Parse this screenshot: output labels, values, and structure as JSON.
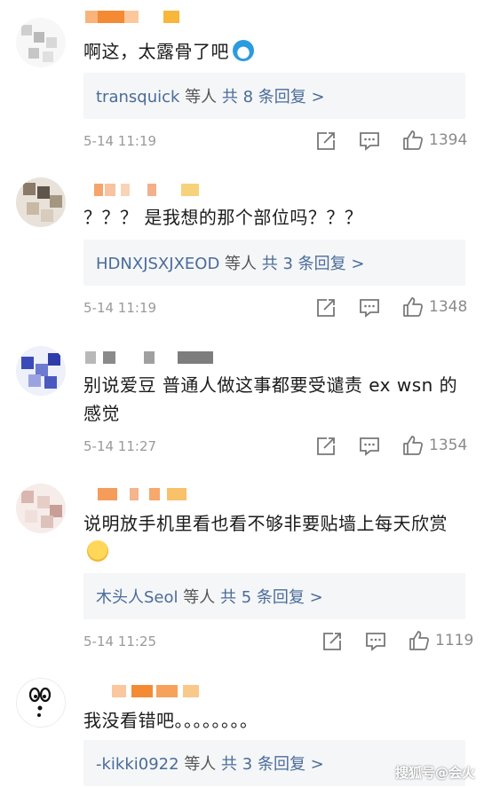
{
  "comments": [
    {
      "text": "啊这，太露骨了吧",
      "reply": {
        "user": "transquick",
        "suffix": "等人",
        "count_text": "共 8 条回复 >"
      },
      "time": "5-14 11:19",
      "likes": "1394"
    },
    {
      "text": "？？？ 是我想的那个部位吗？？？",
      "reply": {
        "user": "HDNXJSXJXEOD",
        "suffix": "等人",
        "count_text": "共 3 条回复 >"
      },
      "time": "5-14 11:19",
      "likes": "1348"
    },
    {
      "text": "别说爱豆 普通人做这事都要受谴责 ex wsn 的感觉",
      "time": "5-14 11:27",
      "likes": "1354"
    },
    {
      "text": "说明放手机里看也看不够非要贴墙上每天欣赏",
      "reply": {
        "user": "木头人Seol",
        "suffix": "等人",
        "count_text": "共 5 条回复 >"
      },
      "time": "5-14 11:25",
      "likes": "1119"
    },
    {
      "text": "我没看错吧。。。。。。。。",
      "reply": {
        "user": "-kikki0922",
        "suffix": "等人",
        "count_text": "共 3 条回复 >"
      }
    }
  ],
  "watermark": "搜狐号@会火",
  "colors": {
    "link": "#4a6c99",
    "meta": "#9a9a9a",
    "reply_bg": "#f5f6f8"
  }
}
